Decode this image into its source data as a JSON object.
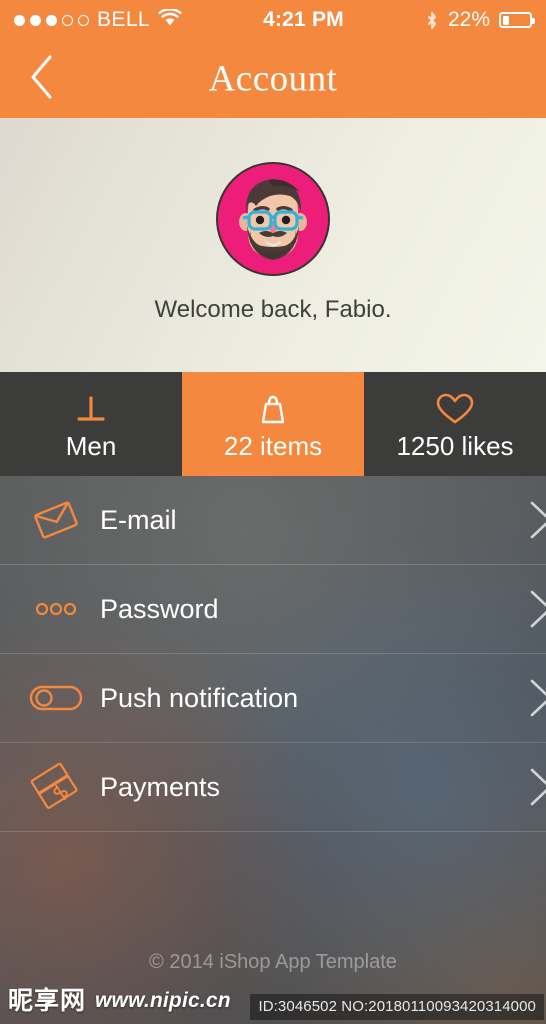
{
  "status_bar": {
    "signal_dots_filled": 3,
    "signal_dots_total": 5,
    "carrier": "BELL",
    "wifi_icon": "wifi-icon",
    "time": "4:21 PM",
    "bluetooth_icon": "bluetooth-icon",
    "battery_percent": "22%",
    "battery_level": 22
  },
  "navbar": {
    "back_icon": "chevron-left-icon",
    "title": "Account"
  },
  "profile": {
    "avatar_alt": "user-avatar",
    "welcome_text": "Welcome back, Fabio."
  },
  "stats": [
    {
      "icon": "clothes-hanger-icon",
      "label": "Men",
      "active": false
    },
    {
      "icon": "shopping-bag-icon",
      "label": "22 items",
      "active": true
    },
    {
      "icon": "heart-icon",
      "label": "1250 likes",
      "active": false
    }
  ],
  "menu": [
    {
      "icon": "envelope-icon",
      "label": "E-mail",
      "chevron": "chevron-right-icon"
    },
    {
      "icon": "three-dots-icon",
      "label": "Password",
      "chevron": "chevron-right-icon"
    },
    {
      "icon": "toggle-switch-icon",
      "label": "Push notification",
      "chevron": "chevron-right-icon"
    },
    {
      "icon": "money-bills-icon",
      "label": "Payments",
      "chevron": "chevron-right-icon"
    }
  ],
  "footer": {
    "copyright": "© 2014 iShop App Template"
  },
  "watermark": {
    "site_cn": "昵享网",
    "site_url": "www.nipic.cn",
    "id_text": "ID:3046502 NO:20180110093420314000"
  },
  "colors": {
    "accent_orange": "#F5883F",
    "tab_dark": "#3C3C3B",
    "avatar_pink": "#ED1E79",
    "glasses_blue": "#31B2D8",
    "hair_brown": "#4A3B38"
  }
}
